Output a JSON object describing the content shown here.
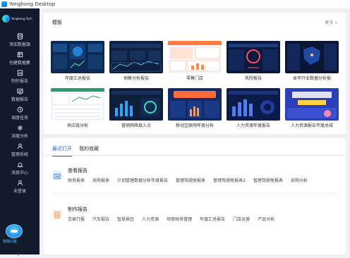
{
  "window": {
    "title": "Yonghong Desktop"
  },
  "sidebar": {
    "brand": "Yonghong Tech",
    "items": [
      {
        "label": "添加数据源",
        "icon": "database-add-icon"
      },
      {
        "label": "创建数据集",
        "icon": "dataset-icon"
      },
      {
        "label": "制作报告",
        "icon": "report-icon"
      },
      {
        "label": "数据报告",
        "icon": "data-report-icon"
      },
      {
        "label": "调度任务",
        "icon": "schedule-icon"
      },
      {
        "label": "深度分析",
        "icon": "analysis-icon"
      },
      {
        "label": "管理系统",
        "icon": "user-manage-icon"
      },
      {
        "label": "消息中心",
        "icon": "bell-icon"
      },
      {
        "label": "未登录",
        "icon": "user-icon"
      }
    ],
    "assistant_label": "智能问答",
    "collapse": "«"
  },
  "templates": {
    "title": "模板",
    "more": "更多 »",
    "cards": [
      {
        "caption": "年度汇总报告",
        "theme": "#0d2a55"
      },
      {
        "caption": "销售分析报告",
        "theme": "#0f1f3d"
      },
      {
        "caption": "零售门店",
        "theme": "#f4f6fa"
      },
      {
        "caption": "风险报告",
        "theme": "#0b1a3a"
      },
      {
        "caption": "本年行业数据分析报",
        "theme": "#0a1633"
      },
      {
        "caption": "供应链分析",
        "theme": "#eef3f8"
      },
      {
        "caption": "营销网络接入点",
        "theme": "#0d1f3a"
      },
      {
        "caption": "移动互联网年度分析",
        "theme": "#142a66"
      },
      {
        "caption": "人力资源年度报告",
        "theme": "#0b1b4a"
      },
      {
        "caption": "人力资源报告年度总结",
        "theme": "#2b3fb8"
      }
    ]
  },
  "recent": {
    "tabs": [
      "最近打开",
      "我的收藏"
    ],
    "groups": [
      {
        "title": "查看报告",
        "icon": "view-report-icon",
        "color": "#e8f1fd",
        "links": [
          "财务报表",
          "采购报表",
          "计划管理数据分析年度报告",
          "管理驾驶舱报表",
          "管理驾驶舱报表2",
          "管理驾驶舱报表",
          "采购分析"
        ]
      },
      {
        "title": "制作报告",
        "icon": "make-report-icon",
        "color": "#fdf0e6",
        "links": [
          "交易行报",
          "汽车报告",
          "智慧景区",
          "人力资源",
          "项目财务管理",
          "年度汇总报告",
          "门店运营",
          "产品分析"
        ]
      }
    ]
  }
}
